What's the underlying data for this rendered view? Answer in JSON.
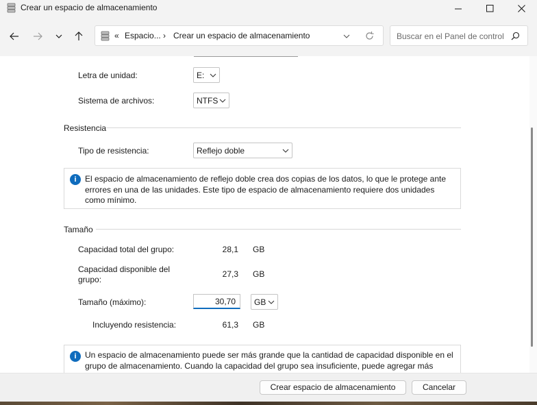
{
  "window": {
    "title": "Crear un espacio de almacenamiento"
  },
  "nav": {
    "breadcrumb_prefix": "«",
    "breadcrumb_parent": "Espacio...",
    "breadcrumb_separator": "›",
    "breadcrumb_current": "Crear un espacio de almacenamiento",
    "search_placeholder": "Buscar en el Panel de control"
  },
  "form": {
    "drive_letter_label": "Letra de unidad:",
    "drive_letter_value": "E:",
    "filesystem_label": "Sistema de archivos:",
    "filesystem_value": "NTFS"
  },
  "resiliency": {
    "section_title": "Resistencia",
    "type_label": "Tipo de resistencia:",
    "type_value": "Reflejo doble",
    "info_text": "El espacio de almacenamiento de reflejo doble crea dos copias de los datos, lo que le protege ante errores en una de las unidades. Este tipo de espacio de almacenamiento requiere dos unidades como mínimo."
  },
  "size": {
    "section_title": "Tamaño",
    "total_label": "Capacidad total del grupo:",
    "total_value": "28,1",
    "total_unit": "GB",
    "available_label": "Capacidad disponible del grupo:",
    "available_value": "27,3",
    "available_unit": "GB",
    "max_label": "Tamaño (máximo):",
    "max_value": "30,70",
    "max_unit": "GB",
    "including_label": "Incluyendo resistencia:",
    "including_value": "61,3",
    "including_unit": "GB",
    "info_text": "Un espacio de almacenamiento puede ser más grande que la cantidad de capacidad disponible en el grupo de almacenamiento. Cuando la capacidad del grupo sea insuficiente, puede agregar más unidades."
  },
  "footer": {
    "create_button": "Crear espacio de almacenamiento",
    "cancel_button": "Cancelar"
  },
  "colors": {
    "accent": "#0f6cbd",
    "chrome": "#f3f3f3"
  }
}
